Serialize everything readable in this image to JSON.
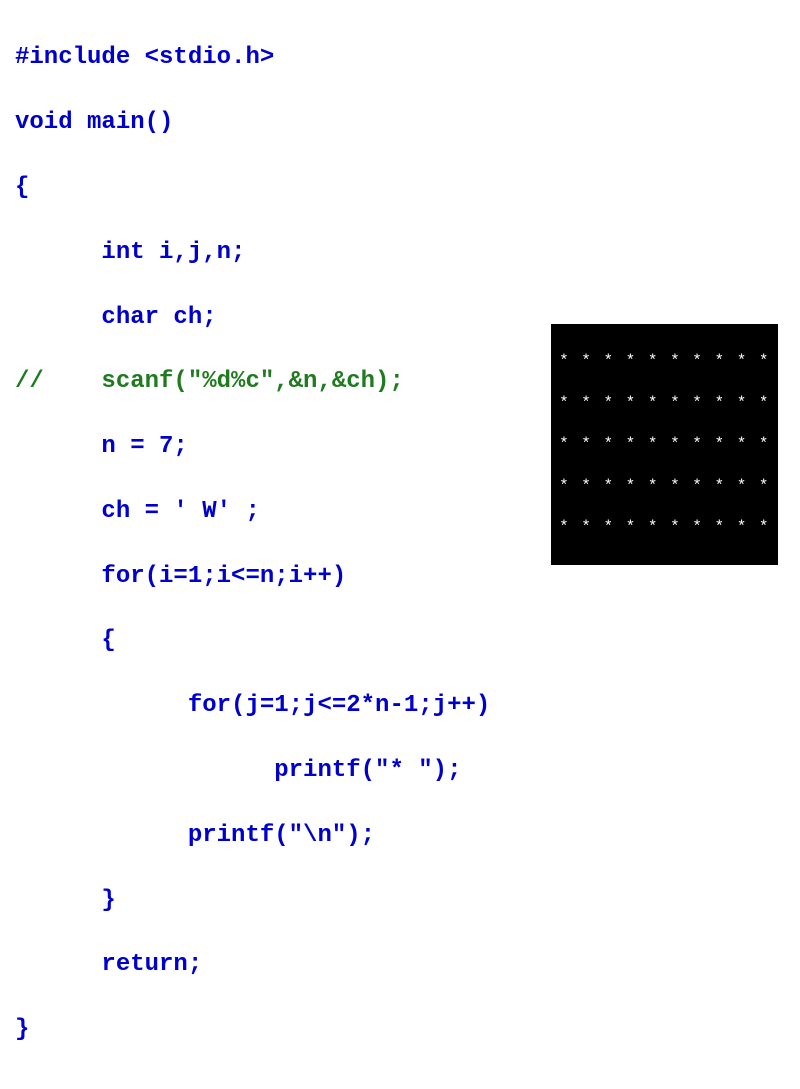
{
  "code": {
    "lines": [
      {
        "text": "#include <stdio.h>",
        "comment": false
      },
      {
        "text": "void main()",
        "comment": false
      },
      {
        "text": "{",
        "comment": false
      },
      {
        "text": "      int i,j,n;",
        "comment": false
      },
      {
        "text": "      char ch;",
        "comment": false
      },
      {
        "text": "//    scanf(\"%d%c\",&n,&ch);",
        "comment": true
      },
      {
        "text": "      n = 7;",
        "comment": false
      },
      {
        "text": "      ch = ' W' ;",
        "comment": false
      },
      {
        "text": "      for(i=1;i<=n;i++)",
        "comment": false
      },
      {
        "text": "      {",
        "comment": false
      },
      {
        "text": "            for(j=1;j<=2*n-1;j++)",
        "comment": false
      },
      {
        "text": "                  printf(\"* \");",
        "comment": false
      },
      {
        "text": "            printf(\"\\n\");",
        "comment": false
      },
      {
        "text": "      }",
        "comment": false
      },
      {
        "text": "      return;",
        "comment": false
      },
      {
        "text": "}",
        "comment": false
      }
    ]
  },
  "output": {
    "rows": [
      "* * * * * * * * * *",
      "* * * * * * * * * *",
      "* * * * * * * * * *",
      "* * * * * * * * * *",
      "* * * * * * * * * *"
    ]
  }
}
